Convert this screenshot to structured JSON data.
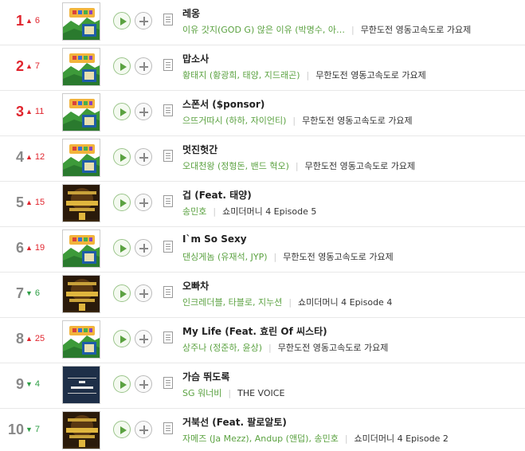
{
  "colors": {
    "rank_top": "#e0252e",
    "rank_other": "#888888",
    "change_up": "#e0252e",
    "change_down": "#2d9e45",
    "artist": "#5ba241"
  },
  "icons": {
    "play": "play-icon",
    "add": "plus-icon",
    "lyrics": "document-icon",
    "up": "arrow-up-icon",
    "down": "arrow-down-icon"
  },
  "rows": [
    {
      "rank": "1",
      "direction": "up",
      "change": "6",
      "cover": "infinite-challenge",
      "title": "레옹",
      "artist": "이유 갓지(GOD G) 않은 이유 (박명수, 아…",
      "album": "무한도전 영동고속도로 가요제"
    },
    {
      "rank": "2",
      "direction": "up",
      "change": "7",
      "cover": "infinite-challenge",
      "title": "맙소사",
      "artist": "황태지 (황광희, 태양, 지드래곤)",
      "album": "무한도전 영동고속도로 가요제"
    },
    {
      "rank": "3",
      "direction": "up",
      "change": "11",
      "cover": "infinite-challenge",
      "title": "스폰서 ($ponsor)",
      "artist": "으뜨거따시 (하하, 자이언티)",
      "album": "무한도전 영동고속도로 가요제"
    },
    {
      "rank": "4",
      "direction": "up",
      "change": "12",
      "cover": "infinite-challenge",
      "title": "멋진헛간",
      "artist": "오대천왕 (정형돈, 밴드 혁오)",
      "album": "무한도전 영동고속도로 가요제"
    },
    {
      "rank": "5",
      "direction": "up",
      "change": "15",
      "cover": "show-me-the-money",
      "title": "겁 (Feat. 태양)",
      "artist": "송민호",
      "album": "쇼미더머니 4 Episode 5"
    },
    {
      "rank": "6",
      "direction": "up",
      "change": "19",
      "cover": "infinite-challenge",
      "title": "I`m So Sexy",
      "artist": "댄싱게놈 (유재석, JYP)",
      "album": "무한도전 영동고속도로 가요제"
    },
    {
      "rank": "7",
      "direction": "down",
      "change": "6",
      "cover": "show-me-the-money",
      "title": "오빠차",
      "artist": "인크레더블, 타블로, 지누션",
      "album": "쇼미더머니 4 Episode 4"
    },
    {
      "rank": "8",
      "direction": "up",
      "change": "25",
      "cover": "infinite-challenge",
      "title": "My Life (Feat. 효린 Of 씨스타)",
      "artist": "상주나 (정준하, 윤상)",
      "album": "무한도전 영동고속도로 가요제"
    },
    {
      "rank": "9",
      "direction": "down",
      "change": "4",
      "cover": "sg-wannabe",
      "title": "가슴 뛰도록",
      "artist": "SG 워너비",
      "album": "THE VOICE"
    },
    {
      "rank": "10",
      "direction": "down",
      "change": "7",
      "cover": "show-me-the-money",
      "title": "거북선 (Feat. 팔로알토)",
      "artist": "자메즈 (Ja Mezz), Andup (앤덥), 송민호",
      "album": "쇼미더머니 4 Episode 2"
    }
  ]
}
